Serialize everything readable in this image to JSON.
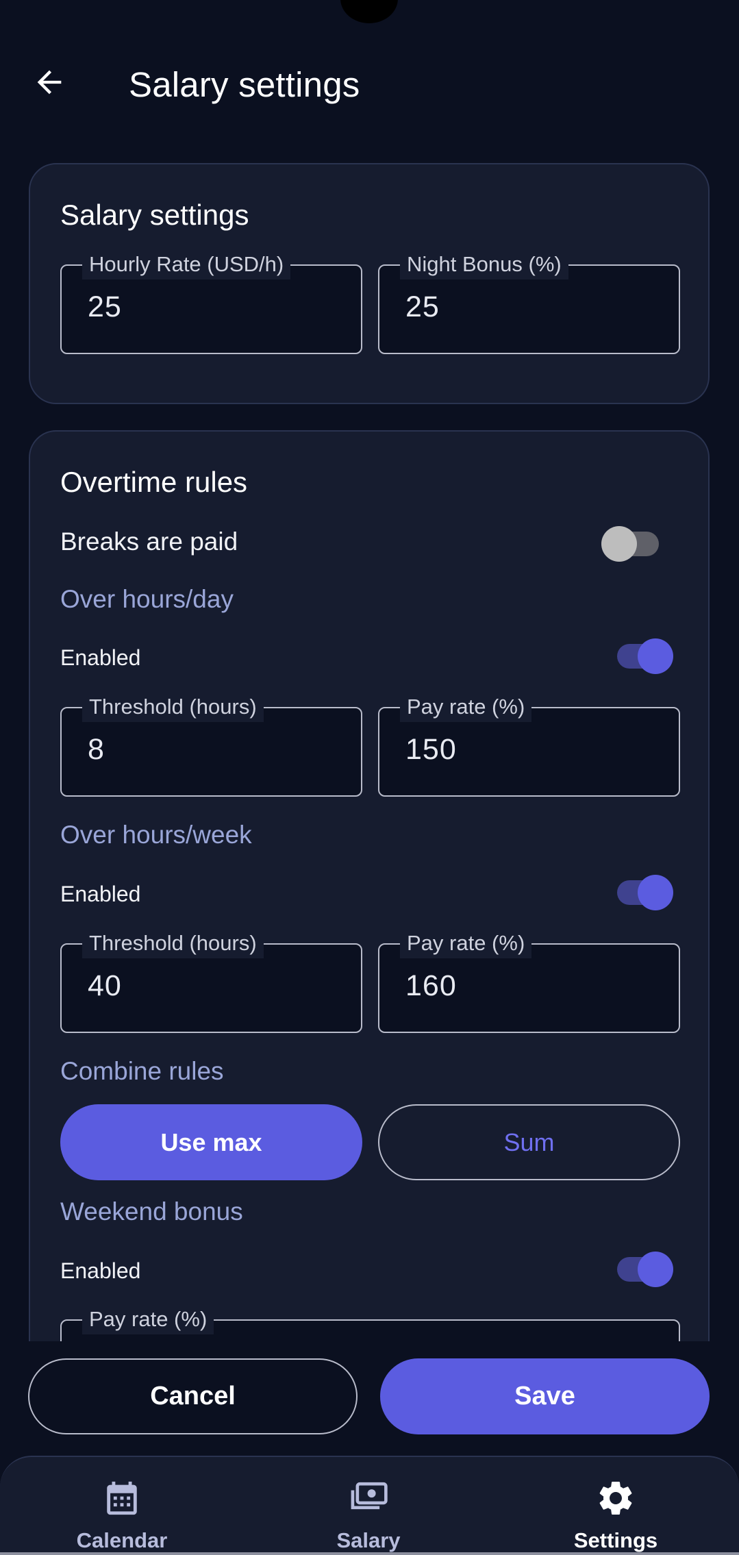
{
  "header": {
    "title": "Salary settings"
  },
  "salary_card": {
    "title": "Salary settings",
    "hourly_rate": {
      "label": "Hourly Rate (USD/h)",
      "value": "25"
    },
    "night_bonus": {
      "label": "Night Bonus (%)",
      "value": "25"
    }
  },
  "overtime_card": {
    "title": "Overtime rules",
    "breaks_paid": {
      "label": "Breaks are paid",
      "enabled": false
    },
    "over_day": {
      "section": "Over hours/day",
      "enabled_label": "Enabled",
      "enabled": true,
      "threshold": {
        "label": "Threshold (hours)",
        "value": "8"
      },
      "pay_rate": {
        "label": "Pay rate (%)",
        "value": "150"
      }
    },
    "over_week": {
      "section": "Over hours/week",
      "enabled_label": "Enabled",
      "enabled": true,
      "threshold": {
        "label": "Threshold (hours)",
        "value": "40"
      },
      "pay_rate": {
        "label": "Pay rate (%)",
        "value": "160"
      }
    },
    "combine": {
      "section": "Combine rules",
      "options": [
        "Use max",
        "Sum"
      ],
      "selected": "Use max"
    },
    "weekend": {
      "section": "Weekend bonus",
      "enabled_label": "Enabled",
      "enabled": true,
      "pay_rate": {
        "label": "Pay rate (%)"
      }
    }
  },
  "actions": {
    "cancel": "Cancel",
    "save": "Save"
  },
  "nav": {
    "items": [
      {
        "label": "Calendar",
        "icon": "calendar-icon",
        "active": false
      },
      {
        "label": "Salary",
        "icon": "money-icon",
        "active": false
      },
      {
        "label": "Settings",
        "icon": "gear-icon",
        "active": true
      }
    ]
  },
  "colors": {
    "background": "#0b1020",
    "card": "#161c2f",
    "accent": "#5b5ce0",
    "section_label": "#9aa6d8"
  }
}
